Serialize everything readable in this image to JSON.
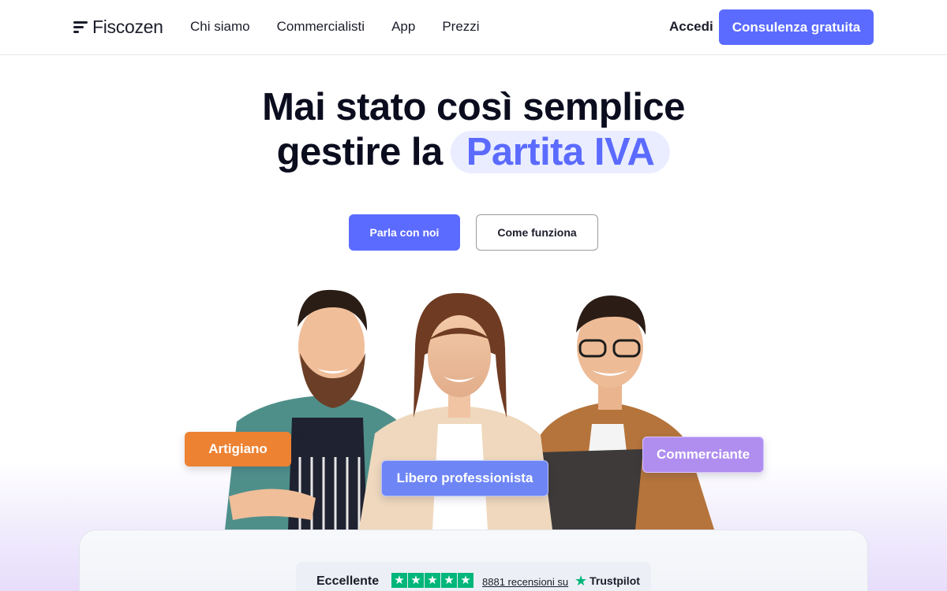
{
  "nav": {
    "logo_text": "Fiscozen",
    "links": [
      "Chi siamo",
      "Commercialisti",
      "App",
      "Prezzi"
    ],
    "login_label": "Accedi",
    "cta_label": "Consulenza gratuita"
  },
  "hero": {
    "title_line1": "Mai stato così semplice",
    "title_line2": "gestire la",
    "title_highlight": "Partita IVA",
    "primary_button": "Parla con noi",
    "secondary_button": "Come funziona"
  },
  "people": {
    "tags": [
      "Artigiano",
      "Libero professionista",
      "Commerciante"
    ]
  },
  "reviews": {
    "rating_label": "Eccellente",
    "stars": 5,
    "count_text": "8881 recensioni su",
    "platform": "Trustpilot"
  },
  "colors": {
    "accent": "#5b6bff",
    "highlight_bg": "#eaedff",
    "tag_artigiano": "#ed8233",
    "tag_libero": "#6e86f5",
    "tag_commerciante": "#b08ef0",
    "trustpilot_green": "#00b67a"
  }
}
